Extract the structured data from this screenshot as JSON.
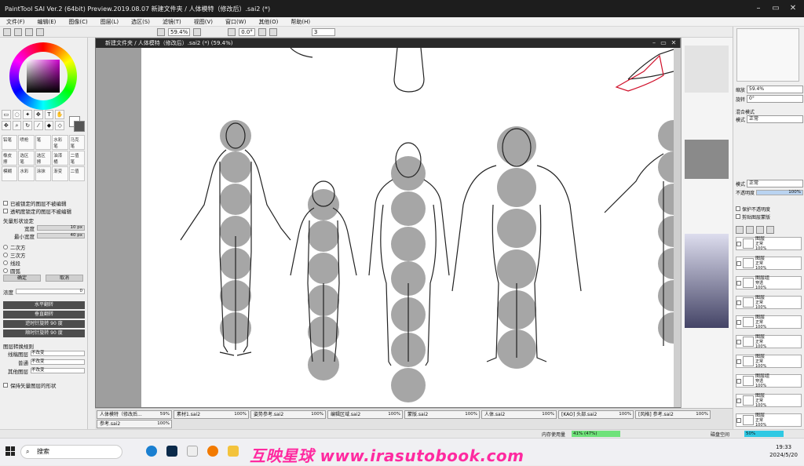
{
  "window": {
    "title": "PaintTool SAI Ver.2 (64bit) Preview.2019.08.07    新建文件夹 / 人体模特（修改后）.sai2 (*)"
  },
  "menu": [
    "文件(F)",
    "编辑(E)",
    "图像(C)",
    "图层(L)",
    "选区(S)",
    "滤镜(T)",
    "视图(V)",
    "窗口(W)",
    "其他(O)",
    "帮助(H)"
  ],
  "toolbar": {
    "zoom": "59.4%",
    "angle": "0.0°",
    "stabilizer": "3"
  },
  "left_panel": {
    "checkbox_1": "已被锁定的图层不被编辑",
    "checkbox_2": "透明度锁定的图层不被编辑",
    "section_label": "矢量形状设定",
    "width_label": "宽度",
    "width_value": "10 px",
    "min_label": "最小宽度",
    "min_value": "40 px",
    "radio_1": "二次方",
    "radio_2": "三次方",
    "radio_3": "线段",
    "radio_4": "圆弧",
    "ok": "确定",
    "cancel": "取消",
    "density_label": "浓度",
    "density_value": "0",
    "btn_flip_h": "水平翻转",
    "btn_flip_v": "垂直翻转",
    "btn_rot_l": "逆时针旋转 90 度",
    "btn_rot_r": "顺时针旋转 90 度",
    "section2": "图层转换规则",
    "r1_label": "线稿图层",
    "r1_val": "不改变",
    "r2_label": "普通",
    "r2_val": "不改变",
    "r3_label": "其他图层",
    "r3_val": "不改变",
    "last_cb": "保持矢量图层的形状"
  },
  "canvas": {
    "title": "新建文件夹 / 人体模特（修改后）.sai2 (*) (59.4%)"
  },
  "right_panel": {
    "zoom_label": "缩放",
    "zoom_val": "59.4%",
    "angle_label": "旋转",
    "angle_val": "0°",
    "section": "混合模式",
    "mode_label": "模式",
    "mode_val": "正常",
    "opacity_label": "不透明度",
    "opacity_val": "100%",
    "cb1": "保护不透明度",
    "cb2": "剪贴图层蒙版"
  },
  "layers": [
    {
      "name": "图层",
      "mode": "正常",
      "opacity": "100%"
    },
    {
      "name": "图层",
      "mode": "正常",
      "opacity": "100%"
    },
    {
      "name": "图层组",
      "mode": "穿透",
      "opacity": "100%"
    },
    {
      "name": "图层",
      "mode": "正常",
      "opacity": "100%"
    },
    {
      "name": "图层",
      "mode": "正常",
      "opacity": "100%"
    },
    {
      "name": "图层",
      "mode": "正常",
      "opacity": "100%"
    },
    {
      "name": "图层",
      "mode": "正常",
      "opacity": "100%"
    },
    {
      "name": "图层组",
      "mode": "穿透",
      "opacity": "100%"
    },
    {
      "name": "图层",
      "mode": "正常",
      "opacity": "100%"
    },
    {
      "name": "图层",
      "mode": "正常",
      "opacity": "100%"
    }
  ],
  "doc_tabs": [
    {
      "name": "人体模特（修改后...",
      "pct": "59%"
    },
    {
      "name": "素材1.sai2",
      "pct": "100%"
    },
    {
      "name": "姿势参考.sai2",
      "pct": "100%"
    },
    {
      "name": "编辑区域.sai2",
      "pct": "100%"
    },
    {
      "name": "蒙版.sai2",
      "pct": "100%"
    },
    {
      "name": "人体.sai2",
      "pct": "100%"
    },
    {
      "name": "[KAO] 头部.sai2",
      "pct": "100%"
    },
    {
      "name": "[风格] 参考.sai2",
      "pct": "100%"
    },
    {
      "name": "参考.sai2",
      "pct": "100%"
    }
  ],
  "status": {
    "memory_label": "内存使用量",
    "memory_val": "41% (47%)",
    "disk_label": "磁盘空间",
    "disk_val": "50%"
  },
  "taskbar": {
    "search_placeholder": "搜索",
    "time": "19:33",
    "date": "2024/5/20"
  },
  "watermark": "互映星球 www.irasutobook.com"
}
